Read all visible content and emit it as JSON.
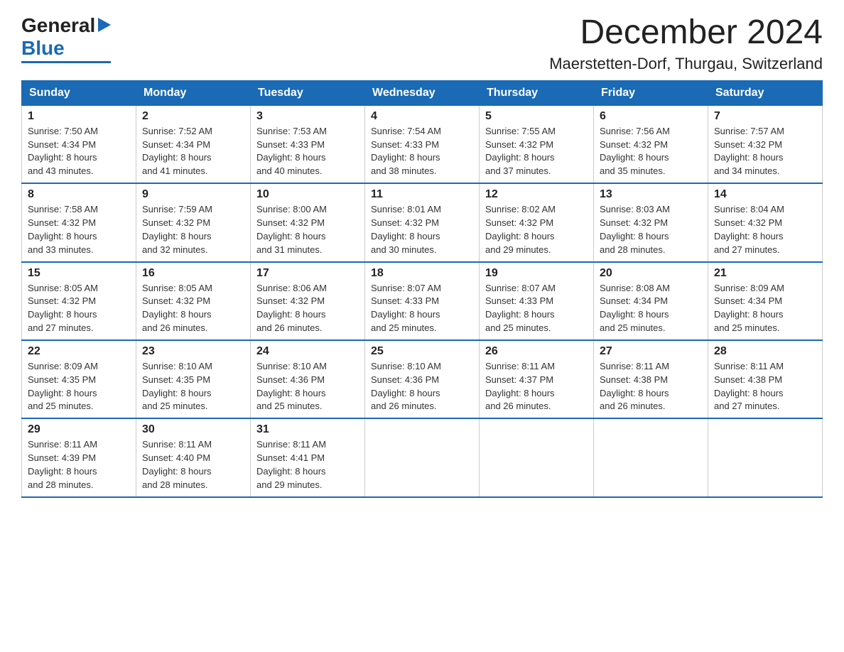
{
  "logo": {
    "general": "General",
    "blue": "Blue",
    "triangle": "▶"
  },
  "header": {
    "title": "December 2024",
    "subtitle": "Maerstetten-Dorf, Thurgau, Switzerland"
  },
  "weekdays": [
    "Sunday",
    "Monday",
    "Tuesday",
    "Wednesday",
    "Thursday",
    "Friday",
    "Saturday"
  ],
  "weeks": [
    [
      {
        "day": "1",
        "sunrise": "7:50 AM",
        "sunset": "4:34 PM",
        "daylight": "8 hours and 43 minutes."
      },
      {
        "day": "2",
        "sunrise": "7:52 AM",
        "sunset": "4:34 PM",
        "daylight": "8 hours and 41 minutes."
      },
      {
        "day": "3",
        "sunrise": "7:53 AM",
        "sunset": "4:33 PM",
        "daylight": "8 hours and 40 minutes."
      },
      {
        "day": "4",
        "sunrise": "7:54 AM",
        "sunset": "4:33 PM",
        "daylight": "8 hours and 38 minutes."
      },
      {
        "day": "5",
        "sunrise": "7:55 AM",
        "sunset": "4:32 PM",
        "daylight": "8 hours and 37 minutes."
      },
      {
        "day": "6",
        "sunrise": "7:56 AM",
        "sunset": "4:32 PM",
        "daylight": "8 hours and 35 minutes."
      },
      {
        "day": "7",
        "sunrise": "7:57 AM",
        "sunset": "4:32 PM",
        "daylight": "8 hours and 34 minutes."
      }
    ],
    [
      {
        "day": "8",
        "sunrise": "7:58 AM",
        "sunset": "4:32 PM",
        "daylight": "8 hours and 33 minutes."
      },
      {
        "day": "9",
        "sunrise": "7:59 AM",
        "sunset": "4:32 PM",
        "daylight": "8 hours and 32 minutes."
      },
      {
        "day": "10",
        "sunrise": "8:00 AM",
        "sunset": "4:32 PM",
        "daylight": "8 hours and 31 minutes."
      },
      {
        "day": "11",
        "sunrise": "8:01 AM",
        "sunset": "4:32 PM",
        "daylight": "8 hours and 30 minutes."
      },
      {
        "day": "12",
        "sunrise": "8:02 AM",
        "sunset": "4:32 PM",
        "daylight": "8 hours and 29 minutes."
      },
      {
        "day": "13",
        "sunrise": "8:03 AM",
        "sunset": "4:32 PM",
        "daylight": "8 hours and 28 minutes."
      },
      {
        "day": "14",
        "sunrise": "8:04 AM",
        "sunset": "4:32 PM",
        "daylight": "8 hours and 27 minutes."
      }
    ],
    [
      {
        "day": "15",
        "sunrise": "8:05 AM",
        "sunset": "4:32 PM",
        "daylight": "8 hours and 27 minutes."
      },
      {
        "day": "16",
        "sunrise": "8:05 AM",
        "sunset": "4:32 PM",
        "daylight": "8 hours and 26 minutes."
      },
      {
        "day": "17",
        "sunrise": "8:06 AM",
        "sunset": "4:32 PM",
        "daylight": "8 hours and 26 minutes."
      },
      {
        "day": "18",
        "sunrise": "8:07 AM",
        "sunset": "4:33 PM",
        "daylight": "8 hours and 25 minutes."
      },
      {
        "day": "19",
        "sunrise": "8:07 AM",
        "sunset": "4:33 PM",
        "daylight": "8 hours and 25 minutes."
      },
      {
        "day": "20",
        "sunrise": "8:08 AM",
        "sunset": "4:34 PM",
        "daylight": "8 hours and 25 minutes."
      },
      {
        "day": "21",
        "sunrise": "8:09 AM",
        "sunset": "4:34 PM",
        "daylight": "8 hours and 25 minutes."
      }
    ],
    [
      {
        "day": "22",
        "sunrise": "8:09 AM",
        "sunset": "4:35 PM",
        "daylight": "8 hours and 25 minutes."
      },
      {
        "day": "23",
        "sunrise": "8:10 AM",
        "sunset": "4:35 PM",
        "daylight": "8 hours and 25 minutes."
      },
      {
        "day": "24",
        "sunrise": "8:10 AM",
        "sunset": "4:36 PM",
        "daylight": "8 hours and 25 minutes."
      },
      {
        "day": "25",
        "sunrise": "8:10 AM",
        "sunset": "4:36 PM",
        "daylight": "8 hours and 26 minutes."
      },
      {
        "day": "26",
        "sunrise": "8:11 AM",
        "sunset": "4:37 PM",
        "daylight": "8 hours and 26 minutes."
      },
      {
        "day": "27",
        "sunrise": "8:11 AM",
        "sunset": "4:38 PM",
        "daylight": "8 hours and 26 minutes."
      },
      {
        "day": "28",
        "sunrise": "8:11 AM",
        "sunset": "4:38 PM",
        "daylight": "8 hours and 27 minutes."
      }
    ],
    [
      {
        "day": "29",
        "sunrise": "8:11 AM",
        "sunset": "4:39 PM",
        "daylight": "8 hours and 28 minutes."
      },
      {
        "day": "30",
        "sunrise": "8:11 AM",
        "sunset": "4:40 PM",
        "daylight": "8 hours and 28 minutes."
      },
      {
        "day": "31",
        "sunrise": "8:11 AM",
        "sunset": "4:41 PM",
        "daylight": "8 hours and 29 minutes."
      },
      null,
      null,
      null,
      null
    ]
  ],
  "labels": {
    "sunrise": "Sunrise: ",
    "sunset": "Sunset: ",
    "daylight": "Daylight: "
  }
}
